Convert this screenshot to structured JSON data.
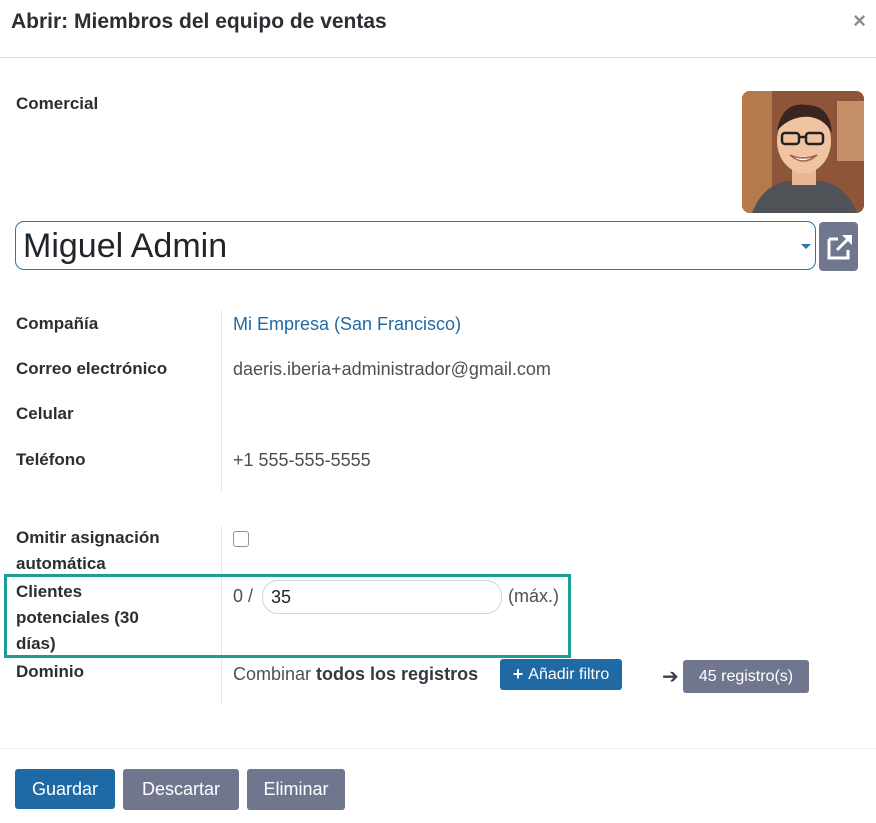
{
  "dialog": {
    "title": "Abrir: Miembros del equipo de ventas",
    "close_icon": "close-icon"
  },
  "form": {
    "salesperson_label": "Comercial",
    "salesperson_value": "Miguel Admin",
    "company_label": "Compañía",
    "company_value": "Mi Empresa (San Francisco)",
    "email_label": "Correo electrónico",
    "email_value": "daeris.iberia+administrador@gmail.com",
    "mobile_label": "Celular",
    "mobile_value": "",
    "phone_label": "Teléfono",
    "phone_value": "+1 555-555-5555",
    "skip_assign_label_line1": "Omitir asignación",
    "skip_assign_label_line2": "automática",
    "skip_assign_checked": false,
    "leads_label_line1": "Clientes",
    "leads_label_line2": "potenciales (30",
    "leads_label_line3": "días)",
    "leads_current": "0 /",
    "leads_max_value": "35",
    "leads_max_suffix": "(máx.)",
    "domain_label": "Dominio",
    "domain_text_prefix": "Combinar",
    "domain_text_bold": "todos los registros",
    "add_filter_label": "Añadir filtro",
    "records_label": "45 registro(s)"
  },
  "footer": {
    "save_label": "Guardar",
    "discard_label": "Descartar",
    "delete_label": "Eliminar"
  },
  "colors": {
    "primary": "#1f6aa5",
    "secondary": "#71768f",
    "highlight": "#1a9e96"
  }
}
